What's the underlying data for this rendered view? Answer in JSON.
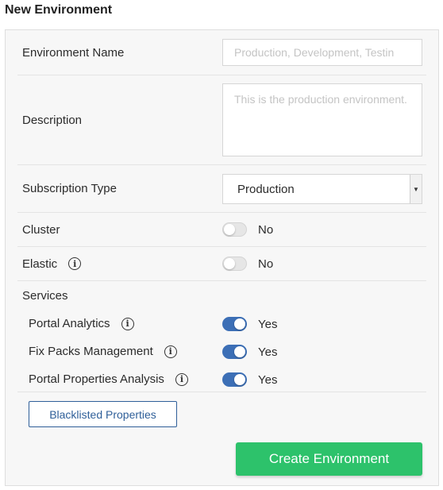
{
  "page": {
    "title": "New Environment"
  },
  "form": {
    "environment_name": {
      "label": "Environment Name",
      "placeholder": "Production, Development, Testin",
      "value": ""
    },
    "description": {
      "label": "Description",
      "placeholder": "This is the production environment.",
      "value": ""
    },
    "subscription_type": {
      "label": "Subscription Type",
      "selected": "Production"
    },
    "cluster": {
      "label": "Cluster",
      "state": "No",
      "enabled": false
    },
    "elastic": {
      "label": "Elastic",
      "state": "No",
      "enabled": false,
      "icon": "info-icon",
      "icon_glyph": "i"
    },
    "services": {
      "label": "Services",
      "items": [
        {
          "label": "Portal Analytics",
          "state": "Yes",
          "enabled": true,
          "icon": "info-icon",
          "icon_glyph": "i"
        },
        {
          "label": "Fix Packs Management",
          "state": "Yes",
          "enabled": true,
          "icon": "info-icon",
          "icon_glyph": "i"
        },
        {
          "label": "Portal Properties Analysis",
          "state": "Yes",
          "enabled": true,
          "icon": "info-icon",
          "icon_glyph": "i"
        }
      ]
    }
  },
  "actions": {
    "blacklisted_label": "Blacklisted Properties",
    "create_label": "Create Environment"
  },
  "colors": {
    "accent": "#3c6fb6",
    "primary_button": "#2dc26b",
    "outline_button": "#2f5f99"
  }
}
